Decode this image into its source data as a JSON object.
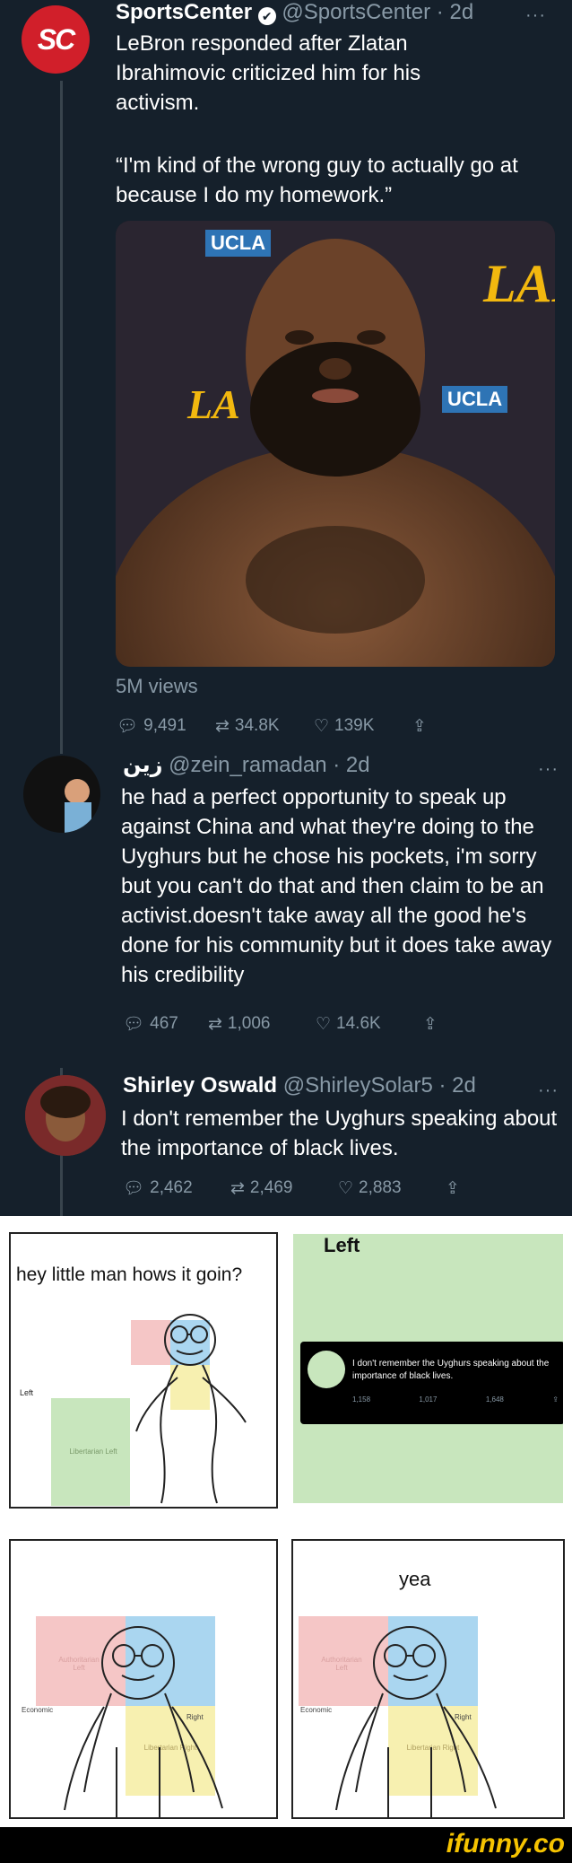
{
  "main_tweet": {
    "name": "SportsCenter",
    "handle": "@SportsCenter · 2d",
    "text": "LeBron responded after Zlatan Ibrahimovic criticized him for his activism.",
    "quote": "“I'm kind of the wrong guy to actually go at because I do my homework.”",
    "video": {
      "tag1": "UCLA",
      "tag2": "UCLA",
      "views": "5M views"
    },
    "replies": "9,491",
    "retweets": "34.8K",
    "likes": "139K"
  },
  "reply1": {
    "name": "زين",
    "handle": "@zein_ramadan · 2d",
    "text": "he had a perfect opportunity to speak up against China and what they're doing to the Uyghurs but he chose his pockets, i'm sorry but you can't do that and then claim to be an activist.doesn't take away all the good he's done for his community but it does take away his credibility",
    "replies": "467",
    "retweets": "1,006",
    "likes": "14.6K"
  },
  "reply2": {
    "name": "Shirley Oswald",
    "handle": "@ShirleySolar5 · 2d",
    "text": "I don't remember the Uyghurs speaking about the importance of black lives.",
    "replies": "2,462",
    "retweets": "2,469",
    "likes": "2,883"
  },
  "comic": {
    "panel1_speech": "hey little man hows it goin?",
    "panel1_left": "Left",
    "panel1_libleft": "Libertarian Left",
    "panel2_left": "Left",
    "panel2_tweet_text": "I don't remember the Uyghurs speaking about the importance of black lives.",
    "panel2_replies": "1,158",
    "panel2_retweets": "1,017",
    "panel2_likes": "1,648",
    "panel3_auth": "Authoritarian Left",
    "panel3_econ": "Economic",
    "panel3_right": "Right",
    "panel3_libright": "Libertarian Right",
    "panel4_speech": "yea",
    "panel4_auth": "Authoritarian Left",
    "panel4_econ": "Economic",
    "panel4_right": "Right",
    "panel4_libright": "Libertarian Right"
  },
  "watermark": "ifunny.co",
  "colors": {
    "background": "#15202b",
    "muted": "#8899a6",
    "twitter_blue": "#1da1f2",
    "sportscenter_red": "#d11f2a"
  }
}
